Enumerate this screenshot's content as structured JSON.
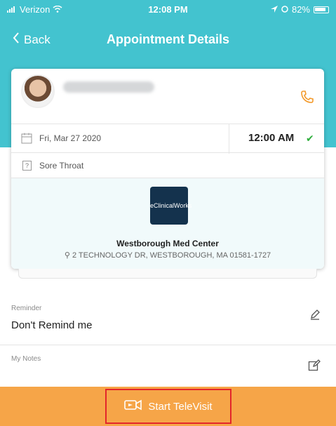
{
  "status": {
    "carrier": "Verizon",
    "time": "12:08 PM",
    "battery": "82%"
  },
  "nav": {
    "back_label": "Back",
    "title": "Appointment Details"
  },
  "appointment": {
    "date": "Fri, Mar 27 2020",
    "time": "12:00 AM",
    "reason": "Sore Throat",
    "facility_logo": "eClinicalWorks",
    "facility_name": "Westborough Med Center",
    "facility_address": "2 TECHNOLOGY DR, WESTBOROUGH, MA 01581-1727"
  },
  "reminder": {
    "label": "Reminder",
    "value": "Don't Remind me"
  },
  "notes": {
    "label": "My Notes"
  },
  "actions": {
    "televisit_label": "Start TeleVisit"
  },
  "colors": {
    "header": "#43c3cf",
    "action_bar": "#f6a548",
    "phone_icon": "#f39a2b",
    "confirmed_check": "#2fae3d",
    "highlight_border": "#e3262b"
  }
}
